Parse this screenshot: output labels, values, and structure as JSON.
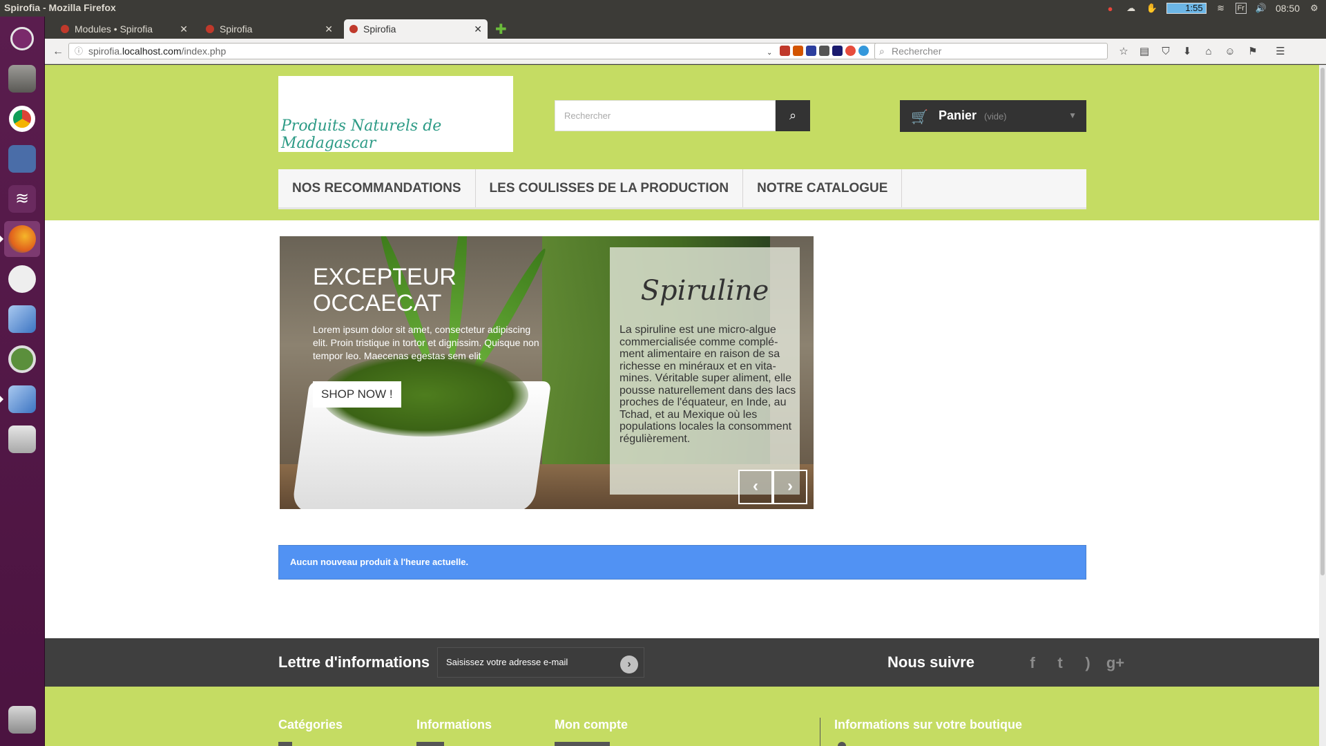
{
  "system": {
    "window_title": "Spirofia - Mozilla Firefox",
    "battery": "1:55",
    "lang": "Fr",
    "clock": "08:50"
  },
  "browser": {
    "tabs": [
      {
        "label": "Modules • Spirofia"
      },
      {
        "label": "Spirofia"
      },
      {
        "label": "Spirofia"
      }
    ],
    "url_prefix": "spirofia.",
    "url_host": "localhost.com",
    "url_path": "/index.php",
    "search_placeholder": "Rechercher"
  },
  "header": {
    "logo_text": "Produits Naturels de Madagascar",
    "search_placeholder": "Rechercher",
    "cart_label": "Panier",
    "cart_status": "(vide)"
  },
  "menu": {
    "items": [
      {
        "label": "NOS RECOMMANDATIONS"
      },
      {
        "label": "LES COULISSES DE LA PRODUCTION"
      },
      {
        "label": "NOTRE CATALOGUE"
      }
    ]
  },
  "slider": {
    "title": "EXCEPTEUR OCCAECAT",
    "text": "Lorem ipsum dolor sit amet, consectetur adipiscing elit. Proin tristique in tortor et dignissim. Quisque non tempor leo. Maecenas egestas sem elit",
    "button": "SHOP NOW !",
    "info_title": "Spiruline",
    "info_body": "La spiruline est une micro-algue commercialisée comme complé-ment alimentaire en raison de sa richesse en minéraux et en vita-mines. Véritable super aliment, elle pousse naturellement dans des lacs proches de l'équateur, en Inde, au Tchad, et au Mexique où les populations locales la consomment régulièrement.",
    "prev": "‹",
    "next": "›"
  },
  "alert": {
    "text": "Aucun nouveau produit à l'heure actuelle."
  },
  "newsletter": {
    "title": "Lettre d'informations",
    "placeholder": "Saisissez votre adresse e-mail",
    "follow": "Nous suivre"
  },
  "footer": {
    "col1": "Catégories",
    "col2": "Informations",
    "col3": "Mon compte",
    "col4": "Informations sur votre boutique"
  },
  "colors": {
    "accent_green": "#c5dc63",
    "alert_blue": "#5192f3",
    "dark": "#333333"
  }
}
